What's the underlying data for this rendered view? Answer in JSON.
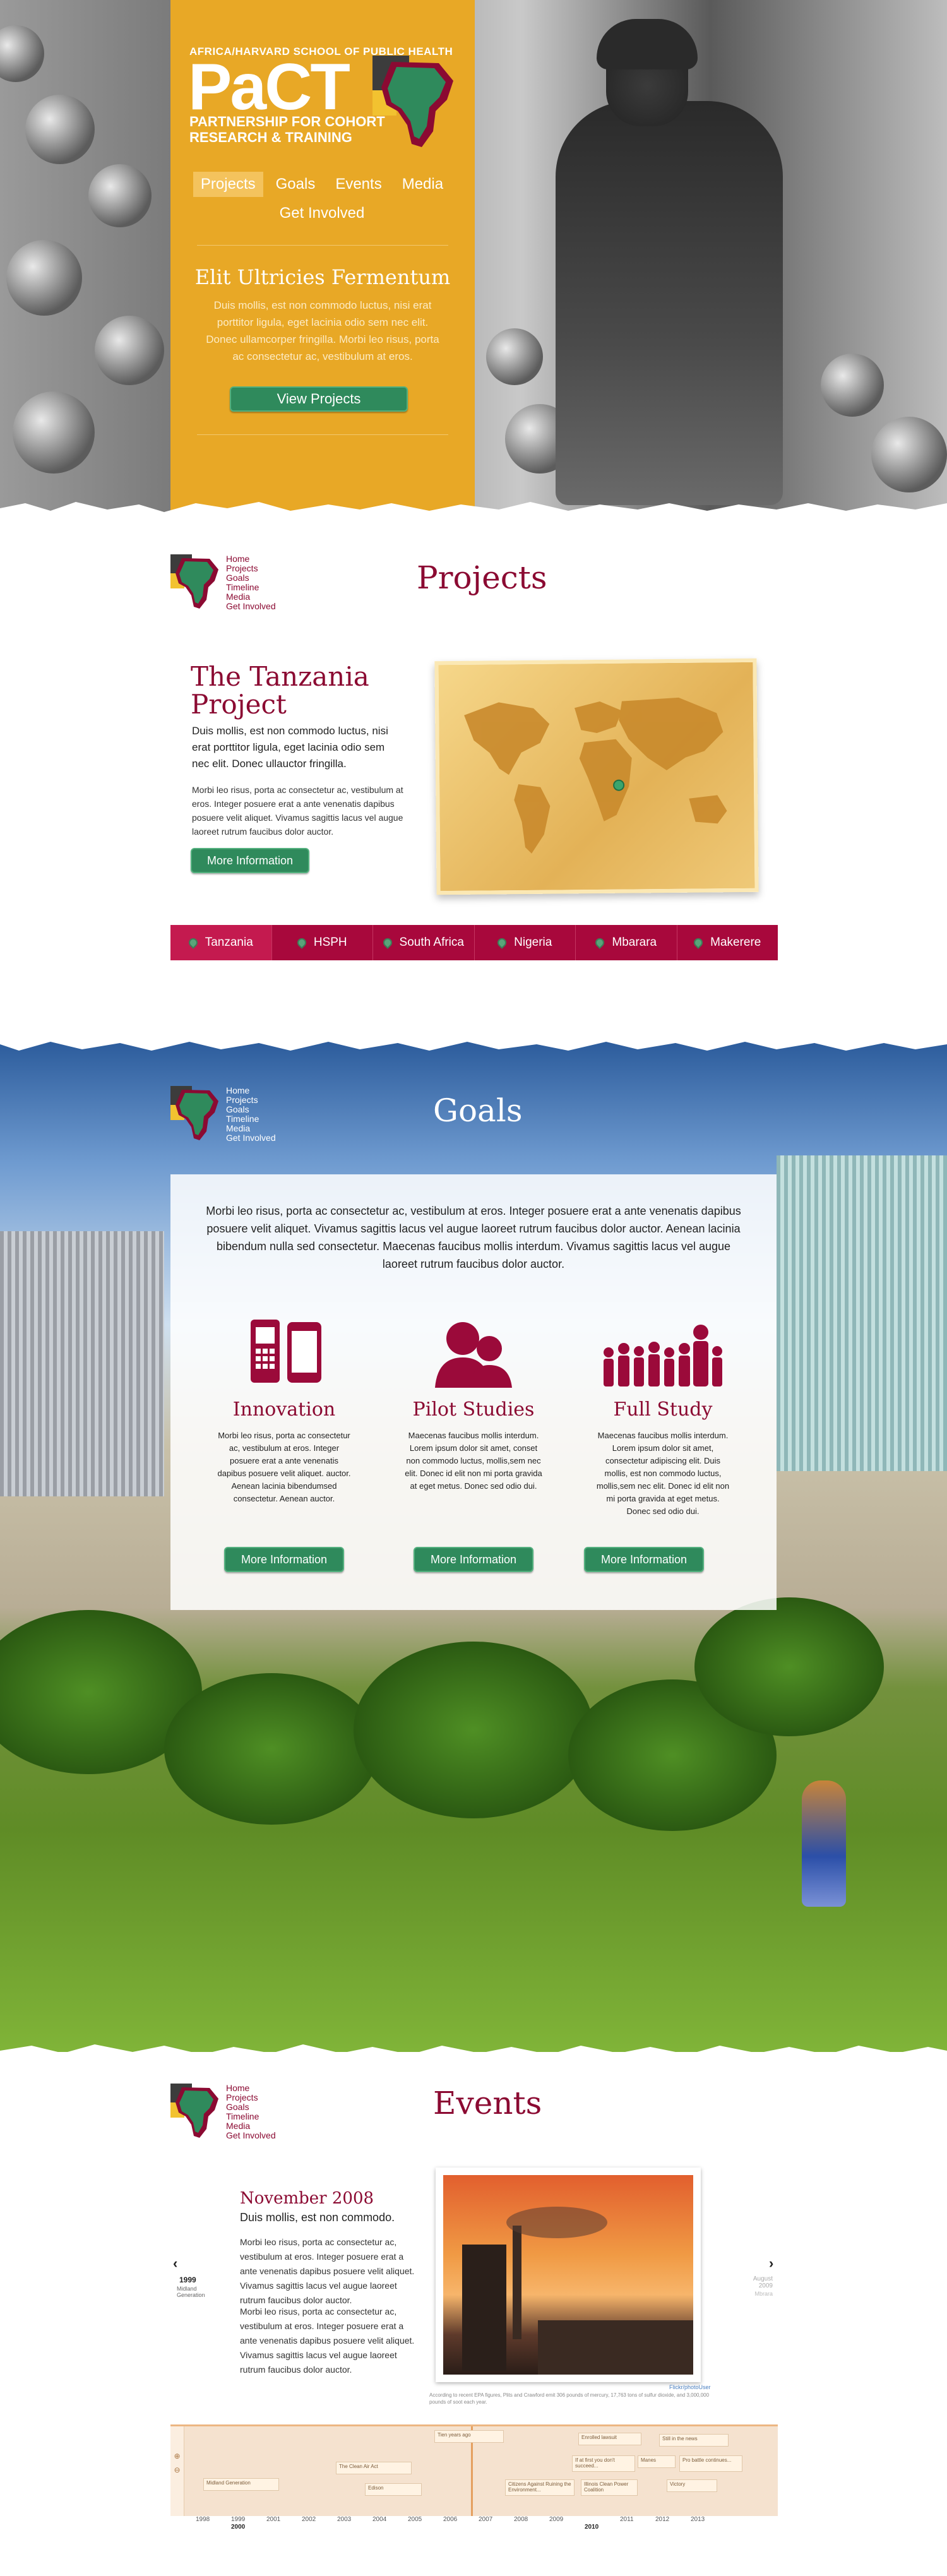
{
  "hero": {
    "kicker": "AFRICA/HARVARD SCHOOL OF PUBLIC HEALTH",
    "logo": "PaCT",
    "subtitle_line1": "PARTNERSHIP FOR COHORT",
    "subtitle_line2": "RESEARCH & TRAINING",
    "nav": [
      "Projects",
      "Goals",
      "Events",
      "Media",
      "Get Involved"
    ],
    "heading": "Elit Ultricies Fermentum",
    "text": "Duis mollis, est non commodo luctus, nisi erat porttitor ligula, eget lacinia odio sem nec elit. Donec ullamcorper fringilla. Morbi leo risus, porta ac consectetur ac, vestibulum at eros.",
    "button": "View Projects"
  },
  "mini_nav": [
    "Home",
    "Projects",
    "Goals",
    "Timeline",
    "Media",
    "Get Involved"
  ],
  "projects": {
    "section_title": "Projects",
    "title": "The Tanzania Project",
    "lead": "Duis mollis, est non commodo luctus, nisi erat porttitor ligula, eget lacinia odio sem nec elit. Donec ullauctor fringilla.",
    "body": "Morbi leo risus, porta ac consectetur ac, vestibulum at eros. Integer posuere erat a ante venenatis dapibus posuere velit aliquet. Vivamus sagittis lacus vel augue laoreet rutrum faucibus dolor auctor.",
    "button": "More Information",
    "tabs": [
      "Tanzania",
      "HSPH",
      "South Africa",
      "Nigeria",
      "Mbarara",
      "Makerere"
    ]
  },
  "goals": {
    "section_title": "Goals",
    "intro": "Morbi leo risus, porta ac consectetur ac, vestibulum at eros. Integer posuere erat a ante venenatis dapibus posuere velit aliquet. Vivamus sagittis lacus vel augue laoreet rutrum faucibus dolor auctor. Aenean lacinia bibendum nulla sed consectetur. Maecenas faucibus mollis interdum. Vivamus sagittis lacus vel augue laoreet rutrum faucibus dolor auctor.",
    "columns": [
      {
        "title": "Innovation",
        "text": "Morbi leo risus, porta ac consectetur ac, vestibulum at eros. Integer posuere erat a ante venenatis dapibus posuere velit aliquet. auctor. Aenean lacinia bibendumsed consectetur. Aenean auctor.",
        "button": "More Information"
      },
      {
        "title": "Pilot Studies",
        "text": "Maecenas faucibus mollis interdum. Lorem ipsum dolor sit amet, conset non commodo luctus, mollis,sem nec elit. Donec id elit non mi porta gravida at eget metus. Donec sed odio dui.",
        "button": "More Information"
      },
      {
        "title": "Full Study",
        "text": "Maecenas faucibus mollis interdum. Lorem ipsum dolor sit amet, consectetur adipiscing elit. Duis mollis, est non commodo luctus, mollis,sem nec elit. Donec id elit non mi porta gravida at eget metus. Donec sed odio dui.",
        "button": "More Information"
      }
    ]
  },
  "events": {
    "section_title": "Events",
    "date": "November 2008",
    "lead": "Duis mollis, est non commodo.",
    "para1": "Morbi leo risus, porta ac consectetur ac, vestibulum at eros. Integer posuere erat a ante venenatis dapibus posuere velit aliquet. Vivamus sagittis lacus vel augue laoreet rutrum faucibus dolor auctor.",
    "para2": "Morbi leo risus, porta ac consectetur ac, vestibulum at eros. Integer posuere erat a ante venenatis dapibus posuere velit aliquet. Vivamus sagittis lacus vel augue laoreet rutrum faucibus dolor auctor.",
    "prev_year": "1999",
    "prev_label": "Midland Generation",
    "next_year": "August 2009",
    "next_label": "Mbrara",
    "photo_credit": "Flickr/photoUser",
    "caption": "According to recent EPA figures, Plits and Crawford emit 306 pounds of mercury, 17,763 tons of sulfur dioxide, and 3,000,000 pounds of soot each year.",
    "timeline_years": [
      "1998",
      "1999",
      "2000",
      "2001",
      "2002",
      "2003",
      "2004",
      "2005",
      "2006",
      "2007",
      "2008",
      "2009",
      "2010",
      "2011",
      "2012",
      "2013"
    ],
    "timeline_items": [
      "Midland Generation",
      "The Clean Air Act",
      "Tien years ago",
      "Edison",
      "Citizens Against Ruining the Environment...",
      "Illinois Clean Power Coalition",
      "Enrolled lawsuit",
      "If at first you don't succeed...",
      "Manes",
      "Still in the news",
      "Pro battle continues...",
      "Victory"
    ]
  }
}
